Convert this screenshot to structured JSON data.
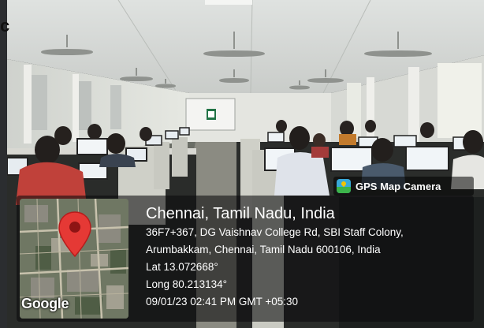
{
  "app": {
    "badge_label": "GPS Map Camera",
    "badge_icon": "gps-map-camera-logo-icon"
  },
  "edge_fragment": "c",
  "location": {
    "title": "Chennai, Tamil Nadu, India",
    "address_line1": "36F7+367, DG Vaishnav College Rd, SBI Staff Colony,",
    "address_line2": "Arumbakkam, Chennai, Tamil Nadu 600106, India",
    "lat": "Lat 13.072668°",
    "long": "Long 80.213134°",
    "datetime": "09/01/23 02:41 PM GMT +05:30"
  },
  "map": {
    "watermark": "Google",
    "pin_color": "#e53935"
  },
  "colors": {
    "panel_bg": "rgba(10,10,12,0.58)",
    "badge_logo": "#39a9d9"
  }
}
